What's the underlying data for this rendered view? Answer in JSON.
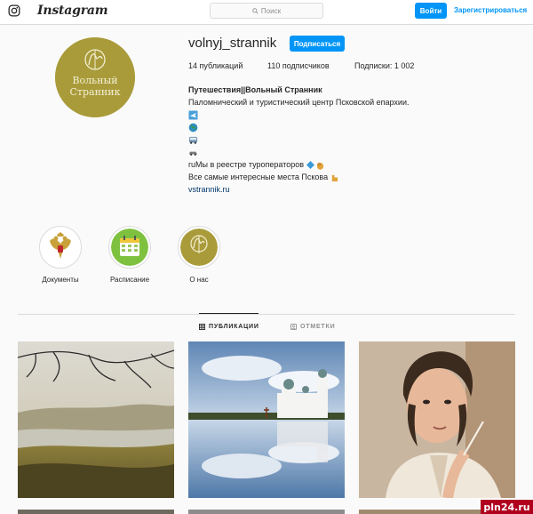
{
  "header": {
    "logo_text": "Instagram",
    "logo_icon": "instagram-glyph-icon",
    "search_placeholder": "Поиск",
    "login_label": "Войти",
    "register_label": "Зарегистрироваться"
  },
  "profile": {
    "username": "volnyj_strannik",
    "follow_label": "Подписаться",
    "avatar_logo_text": [
      "Вольный",
      "Странник"
    ],
    "stats": {
      "posts": "14 публикаций",
      "followers": "110 подписчиков",
      "following": "Подписки: 1 002"
    },
    "bio": {
      "name": "Путешествия||Вольный Странник",
      "line1": "Паломнический и туристический центр Псковской епархии.",
      "emoji_lines": [
        "airplane-icon",
        "globe-icon",
        "bus-icon",
        "car-icon"
      ],
      "line_registry": "ruМы в реестре туроператоров",
      "line_places": "Все самые интересные места Пскова",
      "link": "vstrannik.ru"
    }
  },
  "highlights": [
    {
      "label": "Документы",
      "icon": "coat-of-arms-icon"
    },
    {
      "label": "Расписание",
      "icon": "calendar-icon"
    },
    {
      "label": "О нас",
      "icon": "volnyj-strannik-logo-icon"
    }
  ],
  "tabs": [
    {
      "label": "ПУБЛИКАЦИИ",
      "active": true,
      "icon": "grid-icon"
    },
    {
      "label": "ОТМЕТКИ",
      "active": false,
      "icon": "tag-icon"
    }
  ],
  "posts": [
    {
      "subject": "misty river landscape"
    },
    {
      "subject": "white monastery reflected in lake"
    },
    {
      "subject": "portrait of Pushkin with quill"
    }
  ],
  "watermark": "pln24.ru",
  "colors": {
    "accent": "#0095f6",
    "olive": "#a99b3a",
    "watermark": "#b0001e"
  }
}
